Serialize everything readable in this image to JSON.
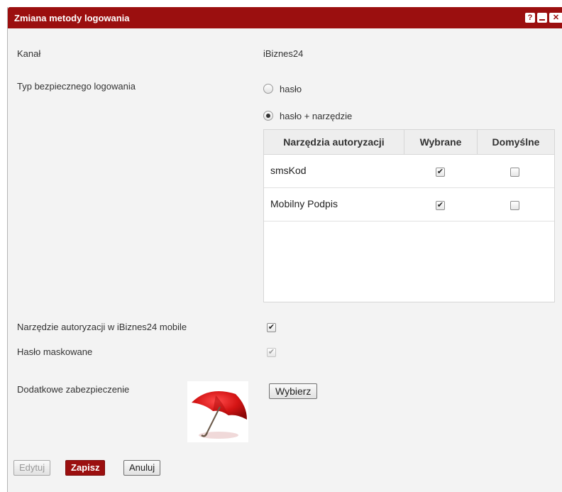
{
  "dialog": {
    "title": "Zmiana metody logowania",
    "help_label": "?",
    "close_label": "✕"
  },
  "form": {
    "channel_label": "Kanał",
    "channel_value": "iBiznes24",
    "login_type_label": "Typ bezpiecznego logowania",
    "login_options": [
      {
        "label": "hasło",
        "checked": false
      },
      {
        "label": "hasło + narzędzie",
        "checked": true
      }
    ],
    "auth_table": {
      "headers": [
        "Narzędzia autoryzacji",
        "Wybrane",
        "Domyślne"
      ],
      "rows": [
        {
          "name": "smsKod",
          "selected": true,
          "default": false
        },
        {
          "name": "Mobilny Podpis",
          "selected": true,
          "default": false
        }
      ]
    },
    "mobile_tool_label": "Narzędzie autoryzacji w iBiznes24 mobile",
    "mobile_tool_checked": true,
    "masked_password_label": "Hasło maskowane",
    "masked_password_checked": true,
    "extra_security_label": "Dodatkowe zabezpieczenie",
    "choose_button": "Wybierz"
  },
  "footer": {
    "edit_button": "Edytuj",
    "save_button": "Zapisz",
    "cancel_button": "Anuluj"
  },
  "colors": {
    "accent": "#9b0f0f",
    "background": "#f3f3f3"
  },
  "icons": {
    "help": "help-icon",
    "minimize": "minimize-icon",
    "close": "close-icon",
    "security_image": "umbrella-icon"
  }
}
